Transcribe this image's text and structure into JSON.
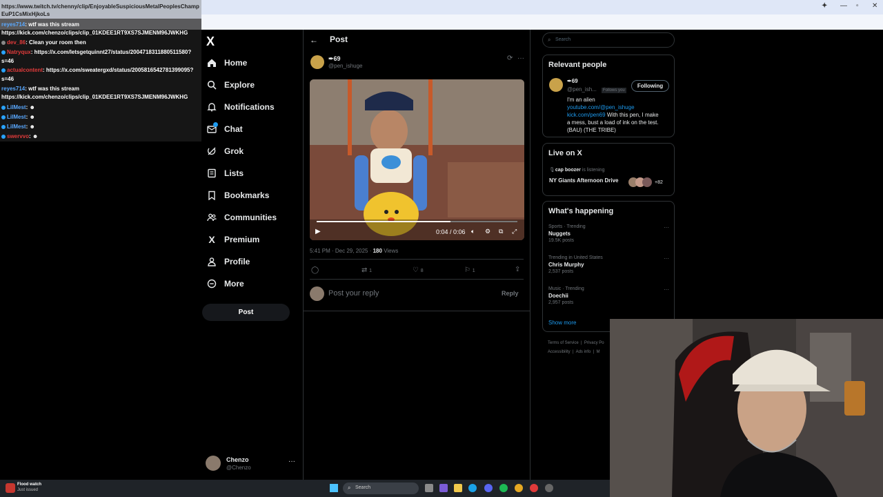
{
  "browser": {
    "url": "https://www.twitch.tv/chenny/clip/EnjoyableSuspiciousMetalPeoplesChamp-EuP1CsMixHjkoLs",
    "url_line1": "https://www.twitch.tv/chenny/clip/EnjoyableSuspiciousMetalPeoplesChamp",
    "url_line2": "EuP1CsMixHjkoLs"
  },
  "chat": {
    "messages": [
      {
        "user": "reyes714",
        "text": " wtf was this stream"
      },
      {
        "user": "",
        "text": "https://kick.com/chenzo/clips/clip_01KDEE1RT9XS7SJMENM96JWKHG"
      },
      {
        "user": "dev_86",
        "text": " Clean your room then"
      },
      {
        "user": "Natryqux",
        "text": " https://x.com/letsgetquinnt27/status/2004718311880511580?"
      },
      {
        "user": "",
        "text": "s=46"
      },
      {
        "user": "actualcontent",
        "text": " https://x.com/sweatergxd/status/2005816542781399095?"
      },
      {
        "user": "",
        "text": "s=46"
      },
      {
        "user": "reyes714",
        "text": " wtf was this stream"
      },
      {
        "user": "",
        "text": "https://kick.com/chenzo/clips/clip_01KDEE1RT9XS7SJMENM96JWKHG"
      },
      {
        "user": "LilMest",
        "text": " ☻"
      },
      {
        "user": "LilMest",
        "text": " ☻"
      },
      {
        "user": "LilMest",
        "text": " ☻"
      },
      {
        "user": "swervvo",
        "text": " ☻"
      }
    ]
  },
  "nav": {
    "logo": "X",
    "items": [
      {
        "label": "Home",
        "icon": "home-icon"
      },
      {
        "label": "Explore",
        "icon": "search-icon"
      },
      {
        "label": "Notifications",
        "icon": "bell-icon"
      },
      {
        "label": "Chat",
        "icon": "mail-icon"
      },
      {
        "label": "Grok",
        "icon": "grok-icon"
      },
      {
        "label": "Lists",
        "icon": "list-icon"
      },
      {
        "label": "Bookmarks",
        "icon": "bookmark-icon"
      },
      {
        "label": "Communities",
        "icon": "people-icon"
      },
      {
        "label": "Premium",
        "icon": "x-icon"
      },
      {
        "label": "Profile",
        "icon": "person-icon"
      },
      {
        "label": "More",
        "icon": "more-circle-icon"
      }
    ],
    "post_label": "Post",
    "account_name": "Chenzo",
    "account_handle": "@Chenzo"
  },
  "post": {
    "header_title": "Post",
    "author_name": "69",
    "author_handle": "@pen_ishuge",
    "video_time": "0:04 / 0:06",
    "timestamp": "5:41 PM · Dec 29, 2025 · ",
    "views_count": "180",
    "views_label": " Views",
    "replies": "",
    "reposts": "1",
    "likes": "8",
    "bookmarks": "1",
    "reply_placeholder": "Post your reply",
    "reply_button": "Reply"
  },
  "right": {
    "search_placeholder": "Search",
    "relevant_title": "Relevant people",
    "rp_name": "69",
    "rp_handle": "@pen_ish...",
    "rp_follows": "Follows you",
    "rp_button": "Following",
    "rp_bio1": "I'm an alien",
    "rp_link1": "youtube.com/@pen_ishuge",
    "rp_link2": "kick.com/pen69",
    "rp_bio2": " With this pen, I make",
    "rp_bio3": "a mess, bust a load of ink on the test.",
    "rp_bio4": "(BAU) (THE TRIBE)",
    "live_title": "Live on X",
    "live_host": "cap boozer",
    "live_status": " is listening",
    "live_show": "NY Giants Afternoon Drive",
    "live_count": "+82",
    "happening_title": "What's happening",
    "trends": [
      {
        "meta": "Sports · Trending",
        "name": "Nuggets",
        "count": "19.5K posts"
      },
      {
        "meta": "Trending in United States",
        "name": "Chris Murphy",
        "count": "2,537 posts"
      },
      {
        "meta": "Music · Trending",
        "name": "Doechii",
        "count": "2,957 posts"
      }
    ],
    "show_more": "Show more",
    "footer1": "Terms of Service  |  Privacy Po",
    "footer2": "Accessibility  |  Ads info  |  M"
  },
  "taskbar": {
    "widget_title": "Flood watch",
    "widget_sub": "Just issued",
    "search_placeholder": "Search"
  },
  "colors": {
    "accent": "#1d9bf0",
    "background": "#000000",
    "border": "#2f3336"
  }
}
